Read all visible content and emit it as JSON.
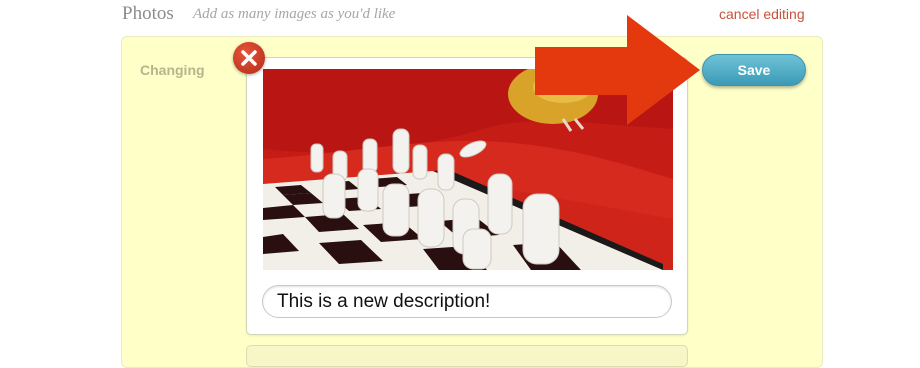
{
  "header": {
    "title": "Photos",
    "subtitle": "Add as many images as you'd like",
    "cancel_label": "cancel editing"
  },
  "photo_item": {
    "status_label": "Changing",
    "description_value": "This is a new description!",
    "remove_icon": "close-icon",
    "photo_subject": "chess-pieces-on-red-couch"
  },
  "actions": {
    "save_label": "Save"
  },
  "colors": {
    "panel_bg": "#ffffc8",
    "save_button": "#4aa9c4",
    "remove_button": "#c8381f",
    "arrow": "#e4380e",
    "link": "#c8523c"
  }
}
